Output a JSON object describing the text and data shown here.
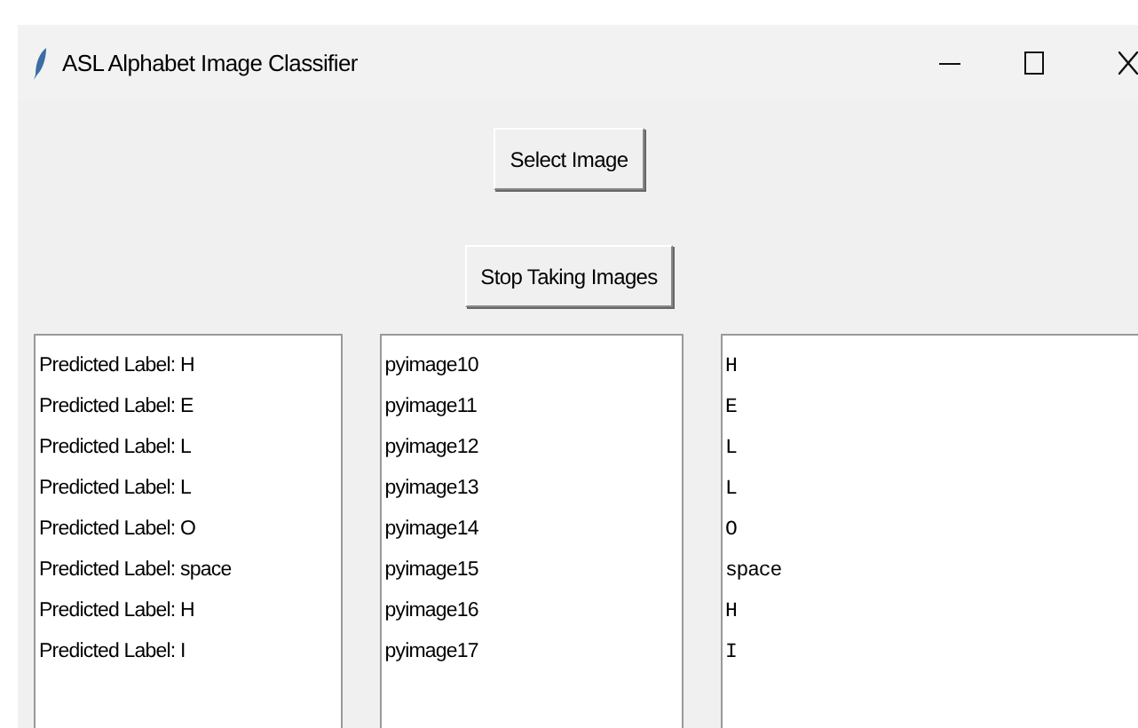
{
  "window": {
    "title": "ASL Alphabet Image Classifier"
  },
  "buttons": [
    {
      "label": "Select Image"
    },
    {
      "label": "Stop Taking Images"
    }
  ],
  "lists": [
    {
      "kind": "labels",
      "items": [
        "Predicted Label: H",
        "Predicted Label: E",
        "Predicted Label: L",
        "Predicted Label: L",
        "Predicted Label: O",
        "Predicted Label: space",
        "Predicted Label: H",
        "Predicted Label: I"
      ]
    },
    {
      "kind": "images",
      "items": [
        "pyimage10",
        "pyimage11",
        "pyimage12",
        "pyimage13",
        "pyimage14",
        "pyimage15",
        "pyimage16",
        "pyimage17"
      ]
    },
    {
      "kind": "text",
      "items": [
        "H",
        "E",
        "L",
        "L",
        "O",
        "space",
        "H",
        "I"
      ]
    }
  ]
}
